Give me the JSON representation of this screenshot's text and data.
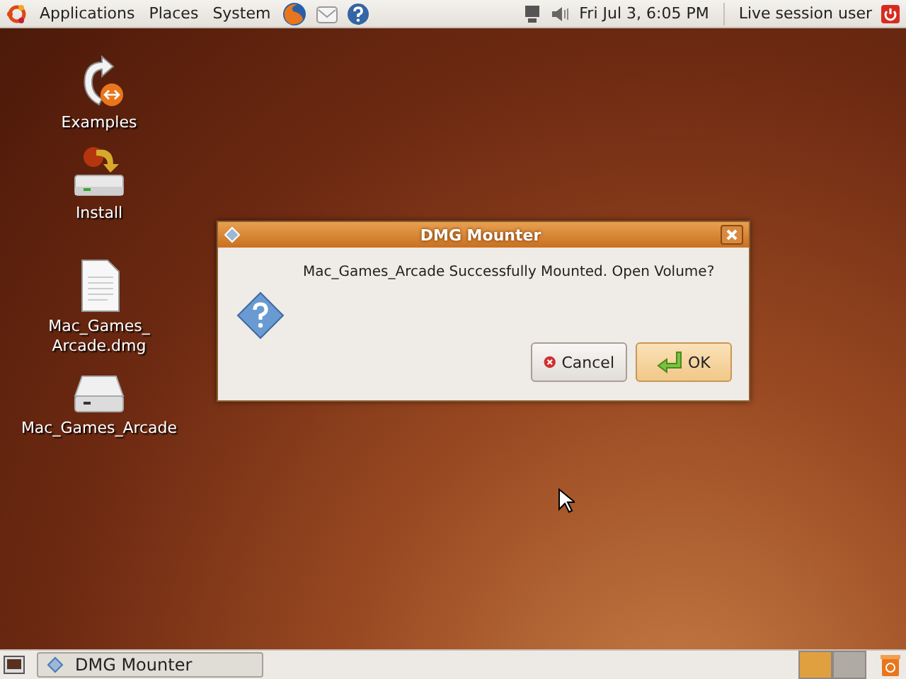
{
  "top_panel": {
    "menus": [
      "Applications",
      "Places",
      "System"
    ],
    "clock": "Fri Jul  3,  6:05 PM",
    "user": "Live session user"
  },
  "desktop_icons": [
    {
      "kind": "link",
      "label": "Examples"
    },
    {
      "kind": "installer",
      "label": "Install"
    },
    {
      "kind": "file",
      "label": "Mac_Games_\nArcade.dmg"
    },
    {
      "kind": "drive",
      "label": "Mac_Games_Arcade"
    }
  ],
  "dialog": {
    "title": "DMG Mounter",
    "message": "Mac_Games_Arcade Successfully Mounted. Open Volume?",
    "buttons": [
      {
        "kind": "cancel",
        "label": "Cancel",
        "selected": false
      },
      {
        "kind": "ok",
        "label": "OK",
        "selected": true
      }
    ]
  },
  "taskbar": {
    "windows": [
      {
        "label": "DMG Mounter",
        "selected": false
      }
    ],
    "workspaces": [
      {
        "selected": true
      },
      {
        "selected": false
      }
    ]
  }
}
